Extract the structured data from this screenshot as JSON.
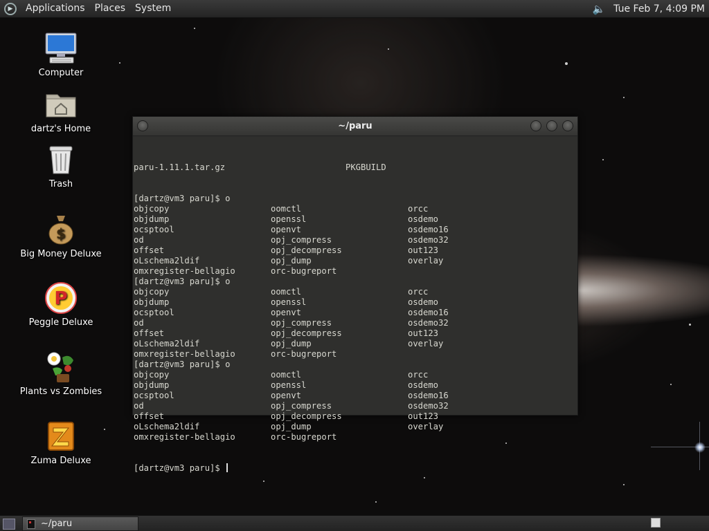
{
  "top_panel": {
    "menus": [
      "Applications",
      "Places",
      "System"
    ],
    "clock": "Tue Feb  7,  4:09 PM",
    "volume_icon": "speaker-icon"
  },
  "desktop_icons": [
    {
      "label": "Computer",
      "icon": "computer-icon"
    },
    {
      "label": "dartz's Home",
      "icon": "home-folder-icon"
    },
    {
      "label": "Trash",
      "icon": "trash-icon"
    },
    {
      "label": "Big Money Deluxe",
      "icon": "money-bag-icon"
    },
    {
      "label": "Peggle Deluxe",
      "icon": "peggle-icon"
    },
    {
      "label": "Plants vs Zombies",
      "icon": "plants-vs-zombies-icon"
    },
    {
      "label": "Zuma Deluxe",
      "icon": "zuma-icon"
    }
  ],
  "window": {
    "title": "~/paru",
    "terminal": {
      "first_line": [
        "paru-1.11.1.tar.gz",
        "PKGBUILD"
      ],
      "prompt": "[dartz@vm3 paru]$ ",
      "typed": "o",
      "listing": [
        [
          "objcopy",
          "oomctl",
          "orcc"
        ],
        [
          "objdump",
          "openssl",
          "osdemo"
        ],
        [
          "ocsptool",
          "openvt",
          "osdemo16"
        ],
        [
          "od",
          "opj_compress",
          "osdemo32"
        ],
        [
          "offset",
          "opj_decompress",
          "out123"
        ],
        [
          "oLschema2ldif",
          "opj_dump",
          "overlay"
        ],
        [
          "omxregister-bellagio",
          "orc-bugreport",
          ""
        ]
      ],
      "repeat_count": 3,
      "final_prompt": "[dartz@vm3 paru]$ "
    }
  },
  "bottom_panel": {
    "taskbar_items": [
      {
        "label": "~/paru",
        "icon": "terminal-icon"
      }
    ]
  }
}
